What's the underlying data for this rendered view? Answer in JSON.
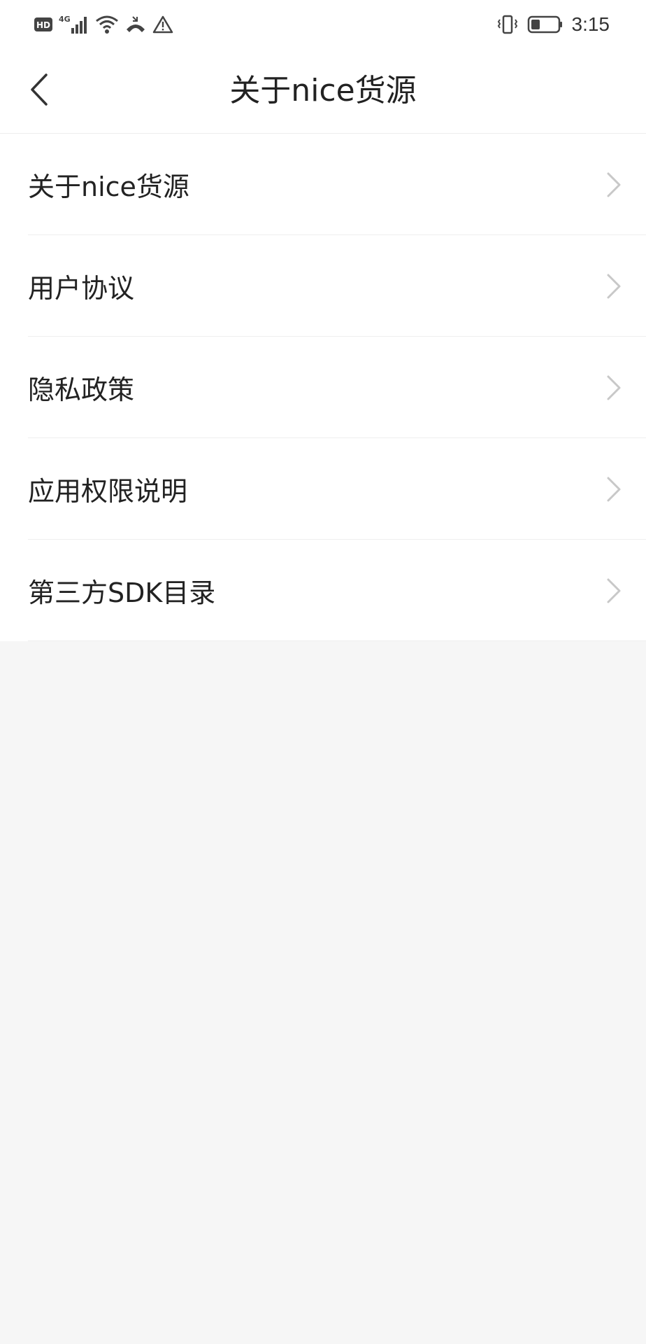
{
  "status_bar": {
    "time": "3:15",
    "network_label": "4G",
    "hd_label": "HD",
    "icons": [
      "hd-icon",
      "signal-4g-icon",
      "wifi-icon",
      "call-icon",
      "warning-icon",
      "vibrate-icon",
      "battery-icon"
    ]
  },
  "nav": {
    "title": "关于nice货源",
    "back_icon": "chevron-left-icon"
  },
  "menu": {
    "items": [
      {
        "label": "关于nice货源"
      },
      {
        "label": "用户协议"
      },
      {
        "label": "隐私政策"
      },
      {
        "label": "应用权限说明"
      },
      {
        "label": "第三方SDK目录"
      }
    ],
    "chevron_icon": "chevron-right-icon"
  },
  "colors": {
    "background": "#f6f6f6",
    "surface": "#ffffff",
    "text_primary": "#222222",
    "chevron": "#c8c8c8",
    "divider": "#eeeeee"
  }
}
